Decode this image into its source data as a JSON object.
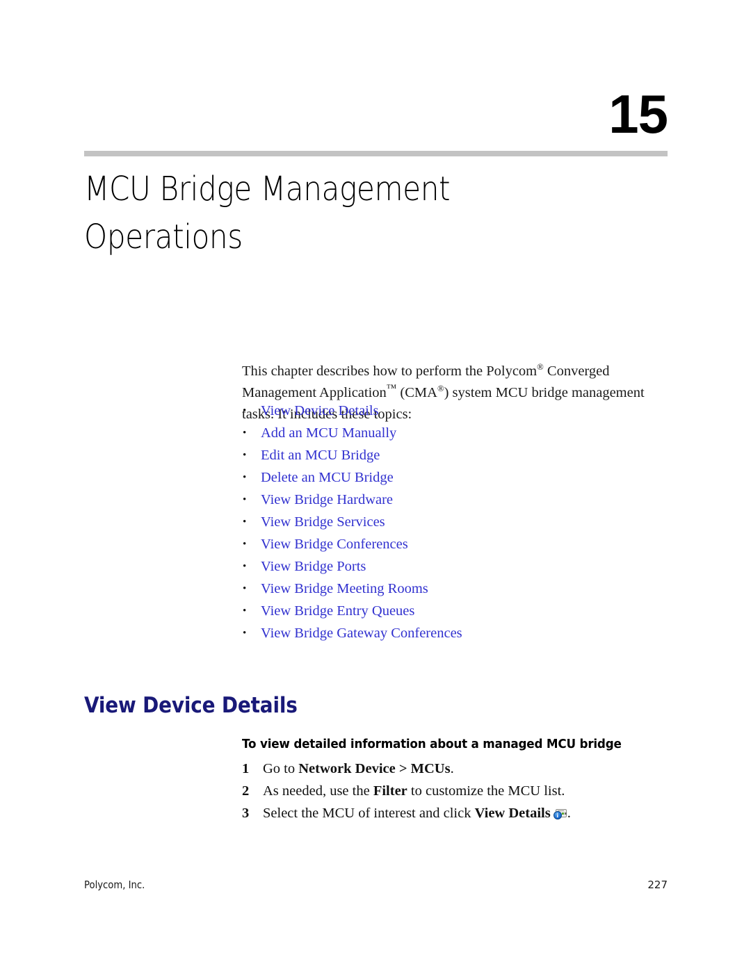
{
  "document": {
    "chapter_number": "15",
    "chapter_title_line1": "MCU Bridge Management",
    "chapter_title_line2": "Operations"
  },
  "intro": {
    "text_part1": "This chapter describes how to perform the Polycom",
    "reg1": "®",
    "text_part2": " Converged Management Application",
    "tm": "™",
    "text_part3": " (CMA",
    "reg2": "®",
    "text_part4": ") system MCU bridge management tasks. It includes these topics:"
  },
  "topics": {
    "bullet_glyph": "•",
    "items": [
      {
        "label": "View Device Details"
      },
      {
        "label": "Add an MCU Manually"
      },
      {
        "label": "Edit an MCU Bridge"
      },
      {
        "label": "Delete an MCU Bridge"
      },
      {
        "label": "View Bridge Hardware"
      },
      {
        "label": "View Bridge Services"
      },
      {
        "label": "View Bridge Conferences"
      },
      {
        "label": "View Bridge Ports"
      },
      {
        "label": "View Bridge Meeting Rooms"
      },
      {
        "label": "View Bridge Entry Queues"
      },
      {
        "label": "View Bridge Gateway Conferences"
      }
    ]
  },
  "section": {
    "heading": "View Device Details",
    "procedure_heading": "To view detailed information about a managed MCU bridge",
    "steps": [
      {
        "number": "1",
        "prefix": "Go to ",
        "bold": "Network Device > MCUs",
        "suffix": ".",
        "has_icon": false
      },
      {
        "number": "2",
        "prefix": "As needed, use the ",
        "bold": "Filter",
        "suffix": " to customize the MCU list.",
        "has_icon": false
      },
      {
        "number": "3",
        "prefix": "Select the MCU of interest and click ",
        "bold": "View Details",
        "suffix": ".",
        "has_icon": true,
        "icon_name": "view-details-device-info-icon"
      }
    ]
  },
  "footer": {
    "company": "Polycom, Inc.",
    "page_number": "227"
  },
  "colors": {
    "link": "#3131cf",
    "heading_navy": "#191978",
    "rule_gray": "#c3c3c3",
    "text_black": "#111111"
  }
}
